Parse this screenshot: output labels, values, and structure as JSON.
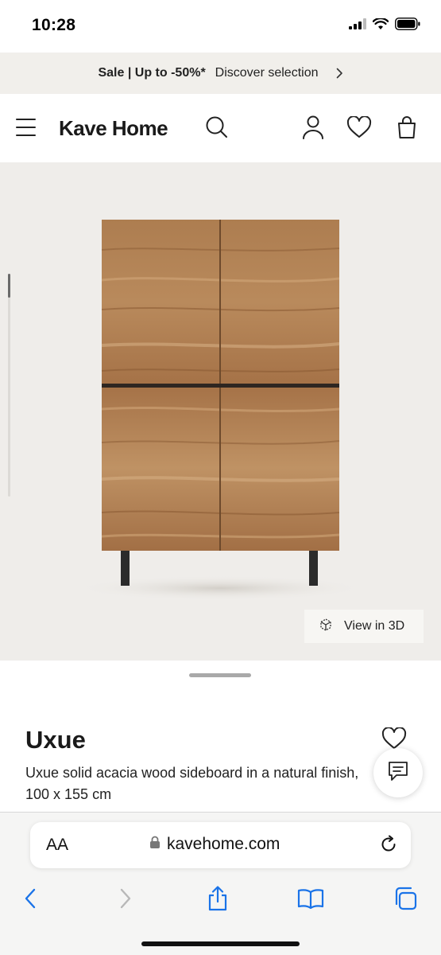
{
  "status_bar": {
    "time": "10:28"
  },
  "promo": {
    "bold": "Sale | Up to -50%*",
    "link": "Discover selection"
  },
  "header": {
    "logo": "Kave Home"
  },
  "product": {
    "view_3d_label": "View in 3D",
    "name": "Uxue",
    "description": "Uxue solid acacia wood sideboard in a natural finish, 100 x 155 cm"
  },
  "browser": {
    "aa_label": "AA",
    "url": "kavehome.com"
  },
  "colors": {
    "accent_blue": "#1a73e8",
    "promo_bg": "#f1efeb",
    "stage_bg": "#efedea",
    "wood": "#a9784c"
  },
  "icons": {
    "menu": "hamburger-icon",
    "search": "search-icon",
    "account": "user-icon",
    "wishlist": "heart-icon",
    "cart": "bag-icon",
    "view3d": "cube-3d-icon",
    "chat": "chat-icon",
    "lock": "lock-icon",
    "reload": "reload-icon",
    "back": "chevron-left-icon",
    "forward": "chevron-right-icon",
    "share": "share-icon",
    "bookmarks": "book-icon",
    "tabs": "tabs-icon"
  }
}
